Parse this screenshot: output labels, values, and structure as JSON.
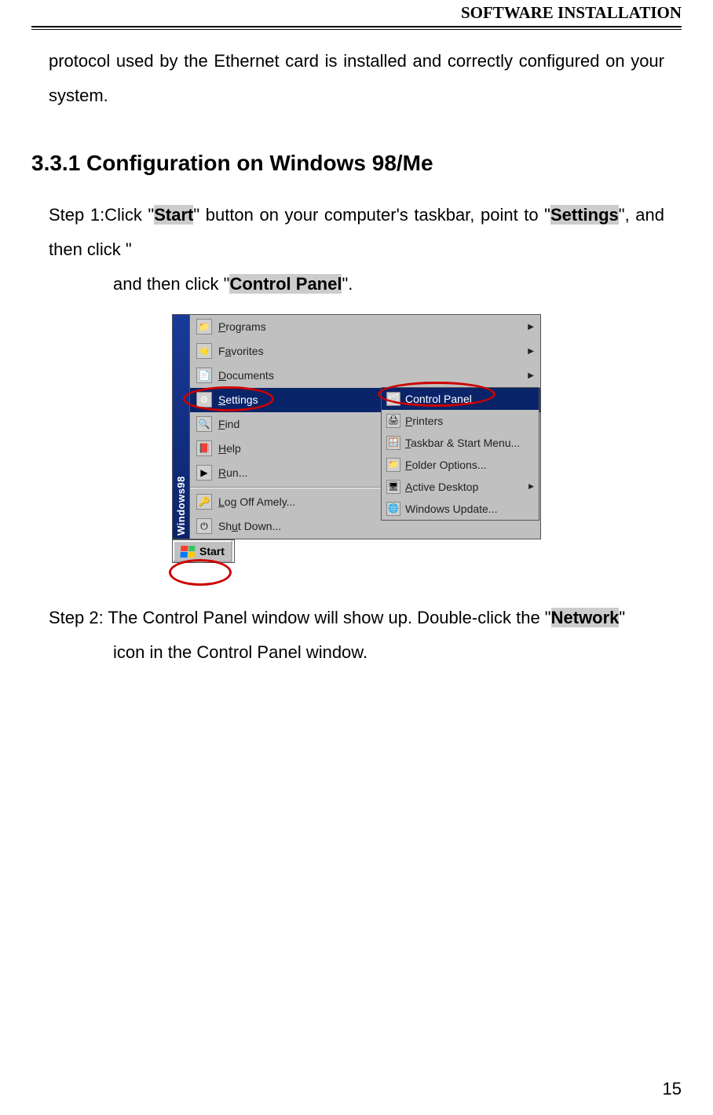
{
  "header": {
    "title": "SOFTWARE INSTALLATION"
  },
  "intro": "protocol used by the Ethernet card is installed and correctly configured on your system.",
  "section": {
    "title": "3.3.1 Configuration on Windows 98/Me"
  },
  "step1": {
    "pre": "Step 1:Click \"",
    "start": "Start",
    "mid1": "\" button on your computer's taskbar, point to \"",
    "settings": "Settings",
    "mid2": "\", and then click \"",
    "control_panel": "Control Panel",
    "post": "\"."
  },
  "menu": {
    "banner": "Windows98",
    "items": [
      {
        "label": "Programs",
        "icon": "📁",
        "arrow": true
      },
      {
        "label": "Favorites",
        "icon": "⭐",
        "arrow": true
      },
      {
        "label": "Documents",
        "icon": "📄",
        "arrow": true
      },
      {
        "label": "Settings",
        "icon": "⚙",
        "arrow": true,
        "highlight": true
      },
      {
        "label": "Find",
        "icon": "🔍",
        "arrow": true
      },
      {
        "label": "Help",
        "icon": "📕",
        "arrow": false
      },
      {
        "label": "Run...",
        "icon": "▶",
        "arrow": false
      },
      {
        "label": "Log Off Amely...",
        "icon": "🔑",
        "arrow": false
      },
      {
        "label": "Shut Down...",
        "icon": "⏻",
        "arrow": false
      }
    ],
    "flyout": [
      {
        "label": "Control Panel",
        "icon": "🗂",
        "highlight": true
      },
      {
        "label": "Printers",
        "icon": "🖨"
      },
      {
        "label": "Taskbar & Start Menu...",
        "icon": "🪟"
      },
      {
        "label": "Folder Options...",
        "icon": "📁"
      },
      {
        "label": "Active Desktop",
        "icon": "🖥",
        "arrow": true
      },
      {
        "label": "Windows Update...",
        "icon": "🌐"
      }
    ],
    "start_label": "Start"
  },
  "step2": {
    "pre": "Step 2: The Control Panel window will show up. Double-click the \"",
    "network": "Network",
    "post": "\" icon in the Control Panel window."
  },
  "page_number": "15"
}
